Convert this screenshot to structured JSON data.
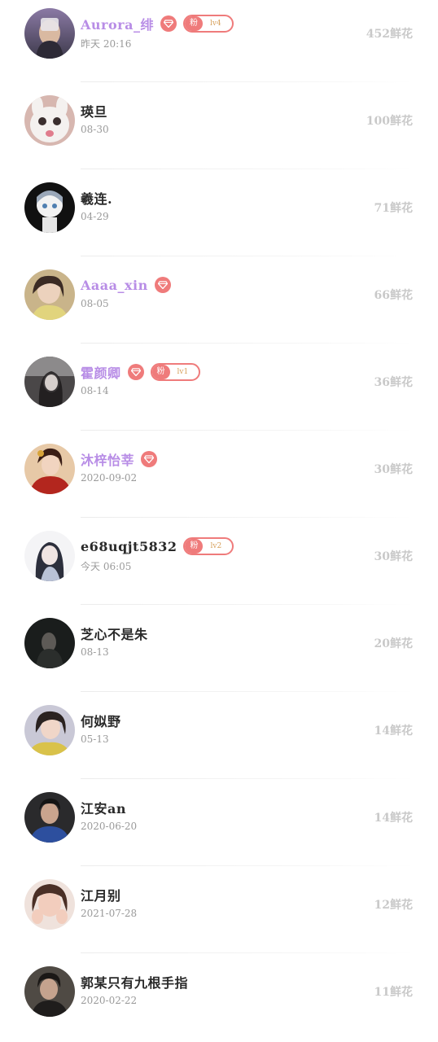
{
  "gift_unit": "鲜花",
  "badge": {
    "gem_icon": "diamond-icon",
    "fan_label": "粉",
    "colors": {
      "badge": "#ef7b7b",
      "vip_name": "#b88de6",
      "level_text": "#d7a15c"
    }
  },
  "rows": [
    {
      "name": "Aurora_绯",
      "vip": true,
      "gem": true,
      "fan_level": "lv4",
      "date": "昨天 20:16",
      "flowers": "452鲜花",
      "avatar": "avatar-photo"
    },
    {
      "name": "瑛旦",
      "vip": false,
      "gem": false,
      "fan_level": "",
      "date": "08-30",
      "flowers": "100鲜花",
      "avatar": "white-kitten-photo"
    },
    {
      "name": "羲连.",
      "vip": false,
      "gem": false,
      "fan_level": "",
      "date": "04-29",
      "flowers": "71鲜花",
      "avatar": "cartoon-girl-drawing"
    },
    {
      "name": "Aaaa_xin",
      "vip": true,
      "gem": true,
      "fan_level": "",
      "date": "08-05",
      "flowers": "66鲜花",
      "avatar": "avatar-photo"
    },
    {
      "name": "霍颜卿",
      "vip": true,
      "gem": true,
      "fan_level": "lv1",
      "date": "08-14",
      "flowers": "36鲜花",
      "avatar": "avatar-photo"
    },
    {
      "name": "沐梓怡莘",
      "vip": true,
      "gem": true,
      "fan_level": "",
      "date": "2020-09-02",
      "flowers": "30鲜花",
      "avatar": "avatar-photo"
    },
    {
      "name": "e68uqjt5832",
      "vip": false,
      "gem": false,
      "fan_level": "lv2",
      "date": "今天 06:05",
      "flowers": "30鲜花",
      "avatar": "anime-avatar"
    },
    {
      "name": "芝心不是朱",
      "vip": false,
      "gem": false,
      "fan_level": "",
      "date": "08-13",
      "flowers": "20鲜花",
      "avatar": "avatar-photo"
    },
    {
      "name": "何姒野",
      "vip": false,
      "gem": false,
      "fan_level": "",
      "date": "05-13",
      "flowers": "14鲜花",
      "avatar": "avatar-photo"
    },
    {
      "name": "江安an",
      "vip": false,
      "gem": false,
      "fan_level": "",
      "date": "2020-06-20",
      "flowers": "14鲜花",
      "avatar": "avatar-photo"
    },
    {
      "name": "江月别",
      "vip": false,
      "gem": false,
      "fan_level": "",
      "date": "2021-07-28",
      "flowers": "12鲜花",
      "avatar": "avatar-photo"
    },
    {
      "name": "郭某只有九根手指",
      "vip": false,
      "gem": false,
      "fan_level": "",
      "date": "2020-02-22",
      "flowers": "11鲜花",
      "avatar": "avatar-photo"
    }
  ]
}
